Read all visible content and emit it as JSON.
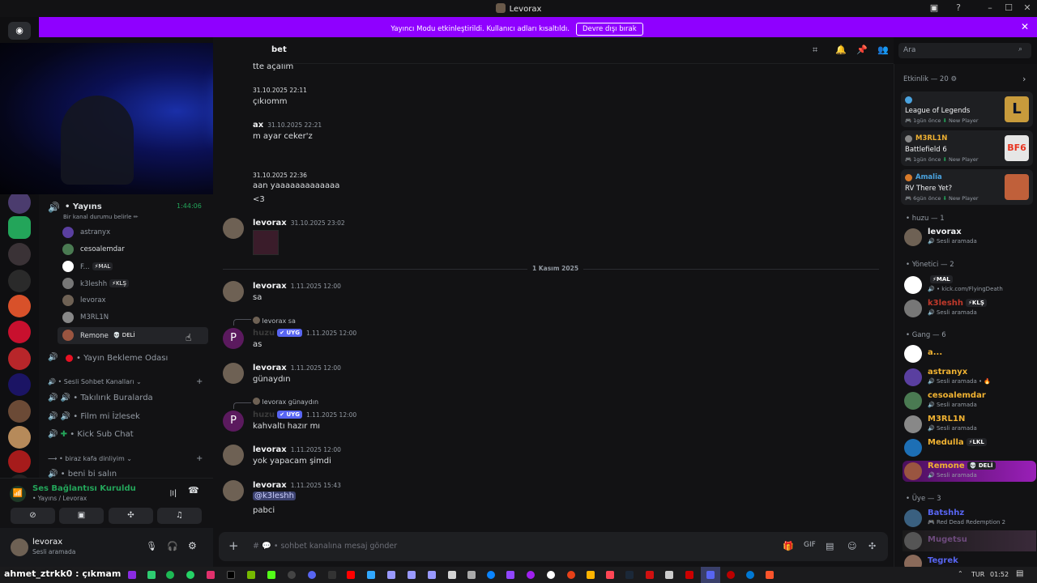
{
  "window": {
    "title": "Levorax",
    "min": "–",
    "max": "☐",
    "close": "✕"
  },
  "banner": {
    "text": "Yayıncı Modu etkinleştirildi. Kullanıcı adları kısaltıldı.",
    "button": "Devre dışı bırak",
    "close": "✕"
  },
  "header": {
    "channel": "bet",
    "search_placeholder": "Ara"
  },
  "voice_channel": {
    "name": "• Yayıns",
    "timer": "1:44:06",
    "status": "Bir kanal durumu belirle ✏",
    "users": [
      {
        "name": "astranyx",
        "badge": ""
      },
      {
        "name": "cesoalemdar",
        "badge": ""
      },
      {
        "name": "F...",
        "badge": "⚡MAL"
      },
      {
        "name": "k3leshh",
        "badge": "⚡KLŞ"
      },
      {
        "name": "levorax",
        "badge": ""
      },
      {
        "name": "M3RL1N",
        "badge": ""
      },
      {
        "name": "Remone",
        "badge": "💀 DELİ"
      }
    ]
  },
  "channels": {
    "waiting": "• Yayın Bekleme Odası",
    "category1": "• Sesli Sohbet Kanalları ⌄",
    "items": [
      "• Takılırık Buralarda",
      "• Film mi İzlesek",
      "• Kick Sub Chat"
    ],
    "category2": "• biraz kafa dinliyim ⌄",
    "last": "• beni bi salın"
  },
  "voice_status": {
    "title": "Ses Bağlantısı Kuruldu",
    "sub": "• Yayıns / Levorax"
  },
  "user": {
    "name": "levorax",
    "status": "Sesli aramada"
  },
  "messages": {
    "m1": {
      "text": "tte açalım"
    },
    "m2": {
      "time": "31.10.2025 22:11",
      "text": "çıkıomm"
    },
    "m3": {
      "name": "ax",
      "time": "31.10.2025 22:21",
      "text": "m ayar ceker'z"
    },
    "m4": {
      "time": "31.10.2025 22:36",
      "text": "aan yaaaaaaaaaaaaa",
      "text2": "<3"
    },
    "m5": {
      "name": "levorax",
      "time": "31.10.2025 23:02"
    },
    "divider": "1 Kasım 2025",
    "m6": {
      "name": "levorax",
      "time": "1.11.2025 12:00",
      "text": "sa"
    },
    "m7": {
      "reply": "levorax sa",
      "name": "huzu",
      "tag": "✔ UYG",
      "time": "1.11.2025 12:00",
      "text": "as"
    },
    "m8": {
      "name": "levorax",
      "time": "1.11.2025 12:00",
      "text": "günaydın"
    },
    "m9": {
      "reply": "levorax günaydın",
      "name": "huzu",
      "tag": "✔ UYG",
      "time": "1.11.2025 12:00",
      "text": "kahvaltı hazır mı"
    },
    "m10": {
      "name": "levorax",
      "time": "1.11.2025 12:00",
      "text": "yok yapacam şimdi"
    },
    "m11": {
      "name": "levorax",
      "time": "1.11.2025 15:43",
      "mention": "@k3leshh",
      "text": "pabci"
    }
  },
  "composer": {
    "placeholder": "• sohbet kanalına mesaj gönder"
  },
  "members": {
    "activity_header": "Etkinlik — 20 ⚙",
    "activities": [
      {
        "user": "",
        "game": "League of Legends",
        "meta": "1gün önce",
        "tag": "New Player"
      },
      {
        "user": "M3RL1N",
        "game": "Battlefield 6",
        "meta": "1gün önce",
        "tag": "New Player"
      },
      {
        "user": "Amalia",
        "game": "RV There Yet?",
        "meta": "6gün önce",
        "tag": "New Player"
      }
    ],
    "groups": [
      {
        "title": "• huzu — 1"
      },
      {
        "title": "• Yönetici — 2"
      },
      {
        "title": "• Gang — 6"
      },
      {
        "title": "• Üye — 3"
      }
    ],
    "list": [
      {
        "name": "levorax",
        "status": "Sesli aramada",
        "color": "#f2f3f5"
      },
      {
        "name": "",
        "badge": "⚡MAL",
        "status": "• kick.com/FlyingDeath",
        "color": "#e03131"
      },
      {
        "name": "k3leshh",
        "badge": "⚡KLŞ",
        "status": "Sesli aramada",
        "color": "#c0392b"
      },
      {
        "name": "a...",
        "status": "",
        "color": "#f0b232"
      },
      {
        "name": "astranyx",
        "status": "Sesli aramada • 🔥",
        "color": "#f0b232"
      },
      {
        "name": "cesoalemdar",
        "status": "Sesli aramada",
        "color": "#f0b232"
      },
      {
        "name": "M3RL1N",
        "status": "Sesli aramada",
        "color": "#f0b232"
      },
      {
        "name": "Medulla",
        "badge": "⚡LKL",
        "status": "",
        "color": "#f0b232"
      },
      {
        "name": "Remone",
        "badge": "💀 DELİ",
        "status": "Sesli aramada",
        "color": "#f0b232"
      },
      {
        "name": "Batshhz",
        "status": "Red Dead Redemption 2",
        "color": "#5865f2"
      },
      {
        "name": "Mugetsu",
        "status": "",
        "color": "#6d4a7c"
      },
      {
        "name": "Tegrek",
        "status": "",
        "color": "#5865f2"
      }
    ]
  },
  "taskbar": {
    "caption": "ahmet_ztrkk0 : çıkmam",
    "lang": "TUR",
    "clock": "01:52"
  },
  "colors": {
    "accent": "#8f00ff",
    "online": "#23a55a",
    "link": "#5865f2"
  }
}
